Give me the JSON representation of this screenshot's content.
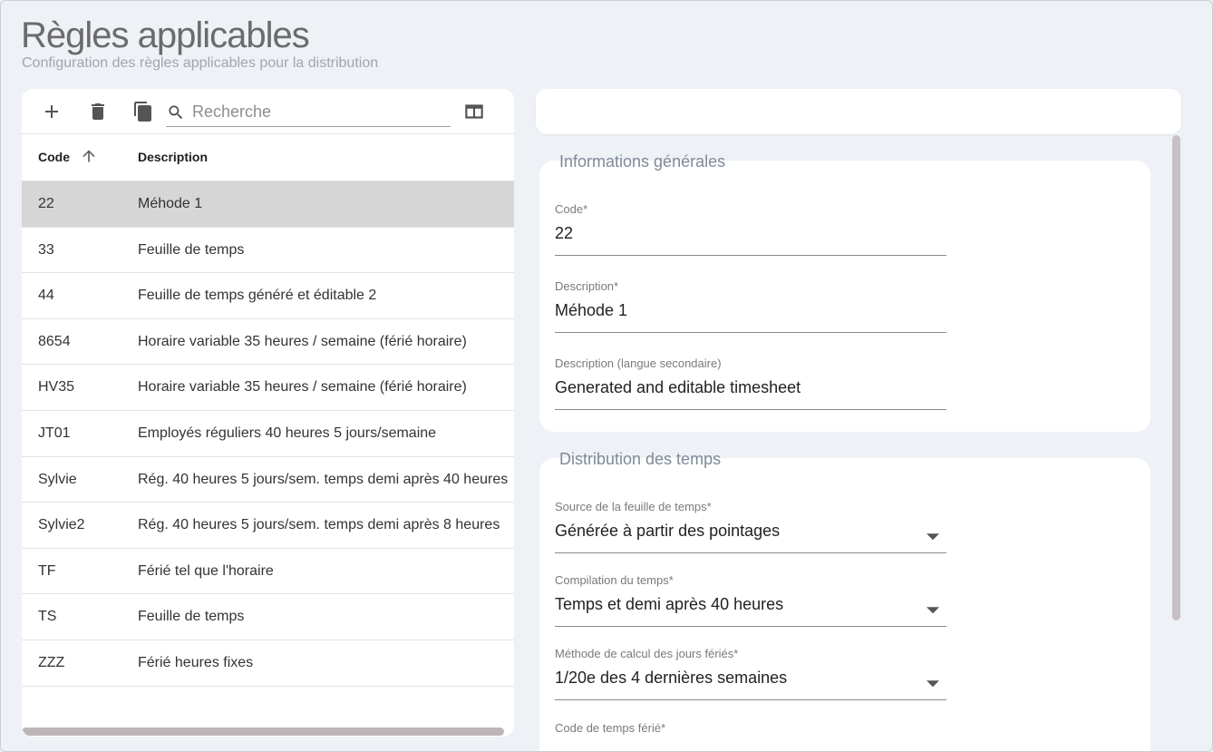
{
  "page": {
    "title": "Règles applicables",
    "subtitle": "Configuration des règles applicables pour la distribution"
  },
  "toolbar": {
    "add_icon": "plus-icon",
    "delete_icon": "trash-icon",
    "copy_icon": "copy-icon",
    "columns_icon": "columns-icon",
    "search_placeholder": "Recherche",
    "search_value": ""
  },
  "table": {
    "columns": [
      "Code",
      "Description"
    ],
    "sort": {
      "column": "Code",
      "direction": "ascending"
    },
    "rows": [
      {
        "code": "22",
        "description": "Méhode 1",
        "selected": true
      },
      {
        "code": "33",
        "description": "Feuille de temps",
        "selected": false
      },
      {
        "code": "44",
        "description": "Feuille de temps généré et éditable 2",
        "selected": false
      },
      {
        "code": "8654",
        "description": "Horaire variable 35 heures / semaine (férié horaire)",
        "selected": false
      },
      {
        "code": "HV35",
        "description": "Horaire variable 35 heures / semaine (férié horaire)",
        "selected": false
      },
      {
        "code": "JT01",
        "description": "Employés réguliers 40 heures 5 jours/semaine",
        "selected": false
      },
      {
        "code": "Sylvie",
        "description": "Rég. 40 heures 5 jours/sem. temps demi après 40 heures",
        "selected": false
      },
      {
        "code": "Sylvie2",
        "description": "Rég. 40 heures 5 jours/sem. temps demi après 8 heures",
        "selected": false
      },
      {
        "code": "TF",
        "description": "Férié tel que l'horaire",
        "selected": false
      },
      {
        "code": "TS",
        "description": "Feuille de temps",
        "selected": false
      },
      {
        "code": "ZZZ",
        "description": "Férié heures fixes",
        "selected": false
      }
    ]
  },
  "general": {
    "title": "Informations générales",
    "fields": [
      {
        "label": "Code*",
        "value": "22"
      },
      {
        "label": "Description*",
        "value": "Méhode 1"
      },
      {
        "label": "Description (langue secondaire)",
        "value": "Generated and editable timesheet"
      }
    ]
  },
  "distribution": {
    "title": "Distribution des temps",
    "fields": [
      {
        "label": "Source de la feuille de temps*",
        "value": "Générée à partir des pointages",
        "dropdown": true
      },
      {
        "label": "Compilation du temps*",
        "value": "Temps et demi après 40 heures",
        "dropdown": true
      },
      {
        "label": "Méthode de calcul des jours fériés*",
        "value": "1/20e des 4 dernières semaines",
        "dropdown": true
      },
      {
        "label": "Code de temps férié*",
        "value": "",
        "dropdown": false
      }
    ]
  },
  "colors": {
    "background": "#eef1f6",
    "selected_row": "#d6d6d6",
    "section_title": "#7e8a98"
  }
}
